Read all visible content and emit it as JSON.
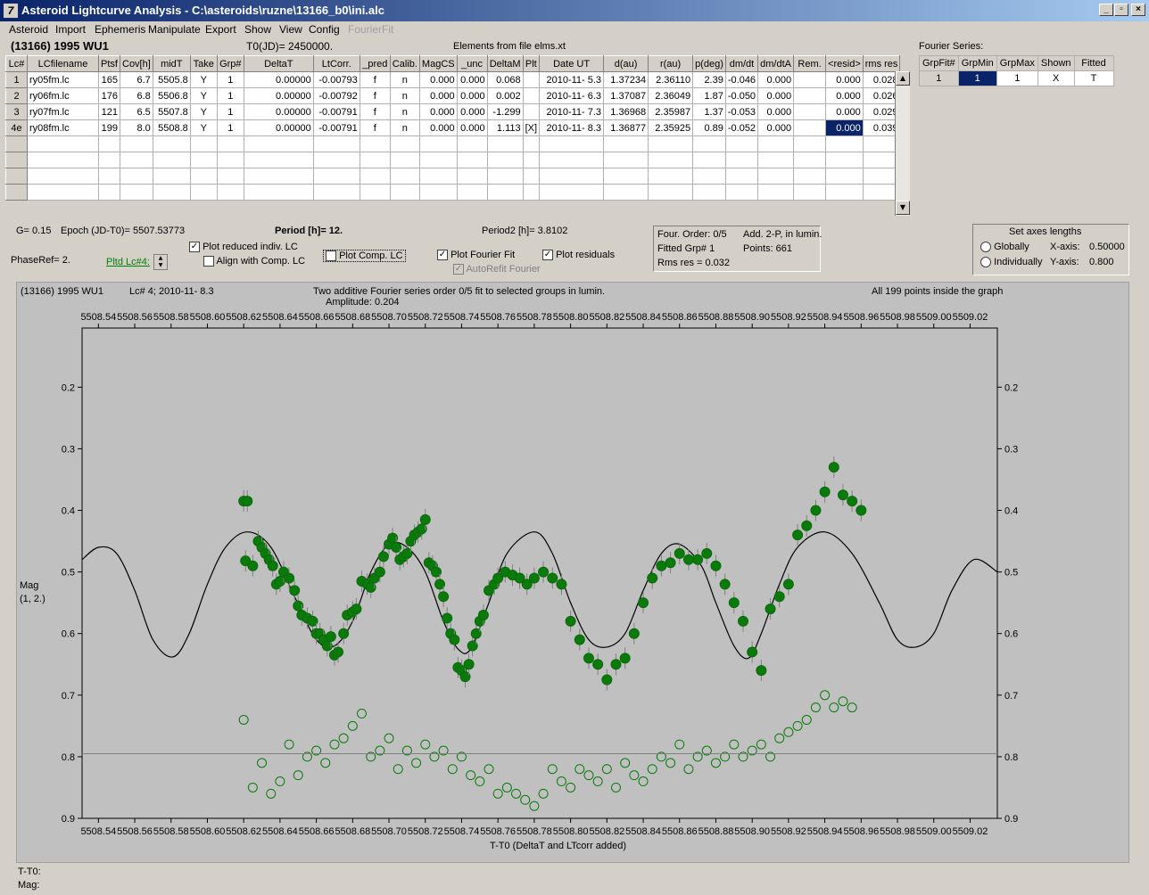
{
  "window": {
    "title": "Asteroid Lightcurve Analysis - C:\\asteroids\\ruzne\\13166_b0\\ini.alc",
    "btn_min": "_",
    "btn_max": "▫",
    "btn_close": "×"
  },
  "menu": [
    "Asteroid",
    "Import",
    "Ephemeris",
    "Manipulate",
    "Export",
    "Show",
    "View",
    "Config",
    "FourierFit"
  ],
  "header": {
    "asteroid": "(13166) 1995 WU1",
    "t0": "T0(JD)= 2450000.",
    "elements": "Elements from file elms.xt",
    "fourier_title": "Fourier Series:"
  },
  "table": {
    "columns": [
      "Lc#",
      "LCfilename",
      "Ptsf",
      "Cov[h]",
      "midT",
      "Take",
      "Grp#",
      "DeltaT",
      "LtCorr.",
      "_pred",
      "Calib.",
      "MagCS",
      "_unc",
      "DeltaM",
      "Plt",
      "Date UT",
      "d(au)",
      "r(au)",
      "p(deg)",
      "dm/dt",
      "dm/dtA",
      "Rem.",
      "<resid>",
      "rms res"
    ],
    "rows": [
      [
        "1",
        "ry05fm.lc",
        "165",
        "6.7",
        "5505.8",
        "Y",
        "1",
        "0.00000",
        "-0.00793",
        "f",
        "n",
        "0.000",
        "0.000",
        "0.068",
        "",
        "2010-11- 5.3",
        "1.37234",
        "2.36110",
        "2.39",
        "-0.046",
        "0.000",
        "",
        "0.000",
        "0.028"
      ],
      [
        "2",
        "ry06fm.lc",
        "176",
        "6.8",
        "5506.8",
        "Y",
        "1",
        "0.00000",
        "-0.00792",
        "f",
        "n",
        "0.000",
        "0.000",
        "0.002",
        "",
        "2010-11- 6.3",
        "1.37087",
        "2.36049",
        "1.87",
        "-0.050",
        "0.000",
        "",
        "0.000",
        "0.026"
      ],
      [
        "3",
        "ry07fm.lc",
        "121",
        "6.5",
        "5507.8",
        "Y",
        "1",
        "0.00000",
        "-0.00791",
        "f",
        "n",
        "0.000",
        "0.000",
        "-1.299",
        "",
        "2010-11- 7.3",
        "1.36968",
        "2.35987",
        "1.37",
        "-0.053",
        "0.000",
        "",
        "0.000",
        "0.029"
      ],
      [
        "4e",
        "ry08fm.lc",
        "199",
        "8.0",
        "5508.8",
        "Y",
        "1",
        "0.00000",
        "-0.00791",
        "f",
        "n",
        "0.000",
        "0.000",
        "1.113",
        "[X]",
        "2010-11- 8.3",
        "1.36877",
        "2.35925",
        "0.89",
        "-0.052",
        "0.000",
        "",
        "0.000",
        "0.039"
      ]
    ]
  },
  "fourier_table": {
    "columns": [
      "GrpFit#",
      "GrpMin",
      "GrpMax",
      "Shown",
      "Fitted"
    ],
    "row": [
      "1",
      "1",
      "1",
      "X",
      "T"
    ]
  },
  "controls": {
    "g": "G= 0.15",
    "epoch": "Epoch (JD-T0)= 5507.53773",
    "period": "Period [h]= 12.",
    "period2": "Period2 [h]= 3.8102",
    "phaseref": "PhaseRef= 2.",
    "pltd": "Pltd Lc#4:",
    "plot_reduced": "Plot reduced indiv. LC",
    "align": "Align with Comp. LC",
    "plot_comp": "Plot Comp. LC",
    "plot_fourier": "Plot Fourier Fit",
    "plot_resid": "Plot residuals",
    "autorefit": "AutoRefit Fourier",
    "check_on": "✓"
  },
  "info": {
    "order": "Four. Order:  0/5",
    "add": "Add. 2-P, in lumin.",
    "fitted": "Fitted Grp# 1",
    "points": "Points: 661",
    "rms": "Rms res     = 0.032"
  },
  "axes_box": {
    "title": "Set axes lengths",
    "globally": "Globally",
    "individually": "Individually",
    "xaxis_label": "X-axis:",
    "xaxis_value": "0.50000",
    "yaxis_label": "Y-axis:",
    "yaxis_value": "0.800"
  },
  "plot": {
    "top_left": "(13166) 1995 WU1",
    "lc": "Lc# 4; 2010-11- 8.3",
    "fit_title": "Two additive Fourier series order 0/5 fit to selected groups in lumin.",
    "amplitude": "Amplitude: 0.204",
    "inside": "All 199 points inside the graph",
    "ylabel": "Mag",
    "ylabel2": "(1, 2.)",
    "xlabel": "T-T0 (DeltaT and LTcorr added)"
  },
  "status": {
    "t": "T-T0:",
    "mag": "Mag:"
  },
  "chart_data": {
    "type": "scatter",
    "x_ticks": [
      "5508.54",
      "5508.56",
      "5508.58",
      "5508.60",
      "5508.62",
      "5508.64",
      "5508.66",
      "5508.68",
      "5508.70",
      "5508.72",
      "5508.74",
      "5508.76",
      "5508.78",
      "5508.80",
      "5508.82",
      "5508.84",
      "5508.86",
      "5508.88",
      "5508.90",
      "5508.92",
      "5508.94",
      "5508.96",
      "5508.98",
      "5509.00",
      "5509.02"
    ],
    "y_ticks": [
      "0.2",
      "0.3",
      "0.4",
      "0.5",
      "0.6",
      "0.7",
      "0.8",
      "0.9"
    ],
    "xlim": [
      5508.531,
      5509.035
    ],
    "ylim": [
      0.9,
      0.104
    ],
    "series": [
      {
        "type": "line",
        "color": "#000000",
        "points": [
          [
            5508.531,
            0.48
          ],
          [
            5508.54,
            0.46
          ],
          [
            5508.55,
            0.47
          ],
          [
            5508.56,
            0.53
          ],
          [
            5508.57,
            0.61
          ],
          [
            5508.581,
            0.638
          ],
          [
            5508.59,
            0.6
          ],
          [
            5508.6,
            0.52
          ],
          [
            5508.61,
            0.46
          ],
          [
            5508.622,
            0.435
          ],
          [
            5508.635,
            0.46
          ],
          [
            5508.648,
            0.54
          ],
          [
            5508.66,
            0.61
          ],
          [
            5508.67,
            0.62
          ],
          [
            5508.68,
            0.58
          ],
          [
            5508.69,
            0.5
          ],
          [
            5508.7,
            0.455
          ],
          [
            5508.71,
            0.46
          ],
          [
            5508.72,
            0.5
          ],
          [
            5508.73,
            0.58
          ],
          [
            5508.738,
            0.625
          ],
          [
            5508.745,
            0.625
          ],
          [
            5508.755,
            0.55
          ],
          [
            5508.765,
            0.47
          ],
          [
            5508.78,
            0.435
          ],
          [
            5508.79,
            0.47
          ],
          [
            5508.8,
            0.55
          ],
          [
            5508.81,
            0.61
          ],
          [
            5508.82,
            0.622
          ],
          [
            5508.83,
            0.6
          ],
          [
            5508.84,
            0.53
          ],
          [
            5508.85,
            0.47
          ],
          [
            5508.86,
            0.455
          ],
          [
            5508.872,
            0.49
          ],
          [
            5508.88,
            0.55
          ],
          [
            5508.89,
            0.62
          ],
          [
            5508.898,
            0.64
          ],
          [
            5508.905,
            0.6
          ],
          [
            5508.915,
            0.52
          ],
          [
            5508.925,
            0.46
          ],
          [
            5508.94,
            0.435
          ],
          [
            5508.955,
            0.47
          ],
          [
            5508.97,
            0.55
          ],
          [
            5508.98,
            0.61
          ],
          [
            5508.99,
            0.622
          ],
          [
            5509.0,
            0.6
          ],
          [
            5509.01,
            0.53
          ],
          [
            5509.022,
            0.48
          ],
          [
            5509.035,
            0.5
          ]
        ]
      },
      {
        "type": "points",
        "color": "#0a7a0a",
        "filled": true,
        "points": [
          [
            5508.62,
            0.385
          ],
          [
            5508.622,
            0.385
          ],
          [
            5508.621,
            0.482
          ],
          [
            5508.625,
            0.49
          ],
          [
            5508.628,
            0.45
          ],
          [
            5508.63,
            0.46
          ],
          [
            5508.632,
            0.47
          ],
          [
            5508.634,
            0.48
          ],
          [
            5508.636,
            0.49
          ],
          [
            5508.638,
            0.52
          ],
          [
            5508.64,
            0.515
          ],
          [
            5508.642,
            0.5
          ],
          [
            5508.645,
            0.51
          ],
          [
            5508.648,
            0.53
          ],
          [
            5508.65,
            0.555
          ],
          [
            5508.652,
            0.57
          ],
          [
            5508.655,
            0.575
          ],
          [
            5508.658,
            0.58
          ],
          [
            5508.66,
            0.6
          ],
          [
            5508.662,
            0.6
          ],
          [
            5508.664,
            0.61
          ],
          [
            5508.666,
            0.62
          ],
          [
            5508.668,
            0.605
          ],
          [
            5508.67,
            0.635
          ],
          [
            5508.672,
            0.63
          ],
          [
            5508.675,
            0.6
          ],
          [
            5508.677,
            0.57
          ],
          [
            5508.68,
            0.565
          ],
          [
            5508.682,
            0.56
          ],
          [
            5508.685,
            0.515
          ],
          [
            5508.688,
            0.52
          ],
          [
            5508.69,
            0.525
          ],
          [
            5508.692,
            0.51
          ],
          [
            5508.695,
            0.5
          ],
          [
            5508.697,
            0.475
          ],
          [
            5508.7,
            0.455
          ],
          [
            5508.702,
            0.445
          ],
          [
            5508.704,
            0.46
          ],
          [
            5508.706,
            0.48
          ],
          [
            5508.708,
            0.475
          ],
          [
            5508.71,
            0.47
          ],
          [
            5508.712,
            0.45
          ],
          [
            5508.714,
            0.44
          ],
          [
            5508.716,
            0.435
          ],
          [
            5508.718,
            0.43
          ],
          [
            5508.72,
            0.415
          ],
          [
            5508.722,
            0.485
          ],
          [
            5508.724,
            0.49
          ],
          [
            5508.726,
            0.5
          ],
          [
            5508.728,
            0.52
          ],
          [
            5508.73,
            0.54
          ],
          [
            5508.732,
            0.575
          ],
          [
            5508.734,
            0.6
          ],
          [
            5508.736,
            0.61
          ],
          [
            5508.738,
            0.655
          ],
          [
            5508.74,
            0.66
          ],
          [
            5508.742,
            0.67
          ],
          [
            5508.744,
            0.65
          ],
          [
            5508.746,
            0.62
          ],
          [
            5508.748,
            0.6
          ],
          [
            5508.75,
            0.58
          ],
          [
            5508.752,
            0.57
          ],
          [
            5508.755,
            0.53
          ],
          [
            5508.758,
            0.52
          ],
          [
            5508.76,
            0.51
          ],
          [
            5508.764,
            0.5
          ],
          [
            5508.768,
            0.505
          ],
          [
            5508.772,
            0.51
          ],
          [
            5508.776,
            0.52
          ],
          [
            5508.78,
            0.51
          ],
          [
            5508.785,
            0.5
          ],
          [
            5508.79,
            0.51
          ],
          [
            5508.795,
            0.52
          ],
          [
            5508.8,
            0.58
          ],
          [
            5508.805,
            0.61
          ],
          [
            5508.81,
            0.64
          ],
          [
            5508.815,
            0.65
          ],
          [
            5508.82,
            0.675
          ],
          [
            5508.825,
            0.65
          ],
          [
            5508.83,
            0.64
          ],
          [
            5508.835,
            0.6
          ],
          [
            5508.84,
            0.55
          ],
          [
            5508.845,
            0.51
          ],
          [
            5508.85,
            0.49
          ],
          [
            5508.855,
            0.485
          ],
          [
            5508.86,
            0.47
          ],
          [
            5508.865,
            0.48
          ],
          [
            5508.87,
            0.48
          ],
          [
            5508.875,
            0.47
          ],
          [
            5508.88,
            0.49
          ],
          [
            5508.885,
            0.52
          ],
          [
            5508.89,
            0.55
          ],
          [
            5508.895,
            0.58
          ],
          [
            5508.9,
            0.63
          ],
          [
            5508.905,
            0.66
          ],
          [
            5508.91,
            0.56
          ],
          [
            5508.915,
            0.54
          ],
          [
            5508.92,
            0.52
          ],
          [
            5508.925,
            0.44
          ],
          [
            5508.93,
            0.425
          ],
          [
            5508.935,
            0.4
          ],
          [
            5508.94,
            0.37
          ],
          [
            5508.945,
            0.33
          ],
          [
            5508.95,
            0.375
          ],
          [
            5508.955,
            0.385
          ],
          [
            5508.96,
            0.4
          ]
        ]
      },
      {
        "type": "points",
        "color": "#0a7a0a",
        "filled": false,
        "points": [
          [
            5508.62,
            0.74
          ],
          [
            5508.625,
            0.85
          ],
          [
            5508.63,
            0.81
          ],
          [
            5508.635,
            0.86
          ],
          [
            5508.64,
            0.84
          ],
          [
            5508.645,
            0.78
          ],
          [
            5508.65,
            0.83
          ],
          [
            5508.655,
            0.8
          ],
          [
            5508.66,
            0.79
          ],
          [
            5508.665,
            0.81
          ],
          [
            5508.67,
            0.78
          ],
          [
            5508.675,
            0.77
          ],
          [
            5508.68,
            0.75
          ],
          [
            5508.685,
            0.73
          ],
          [
            5508.69,
            0.8
          ],
          [
            5508.695,
            0.79
          ],
          [
            5508.7,
            0.77
          ],
          [
            5508.705,
            0.82
          ],
          [
            5508.71,
            0.79
          ],
          [
            5508.715,
            0.81
          ],
          [
            5508.72,
            0.78
          ],
          [
            5508.725,
            0.8
          ],
          [
            5508.73,
            0.79
          ],
          [
            5508.735,
            0.82
          ],
          [
            5508.74,
            0.8
          ],
          [
            5508.745,
            0.83
          ],
          [
            5508.75,
            0.84
          ],
          [
            5508.755,
            0.82
          ],
          [
            5508.76,
            0.86
          ],
          [
            5508.765,
            0.85
          ],
          [
            5508.77,
            0.86
          ],
          [
            5508.775,
            0.87
          ],
          [
            5508.78,
            0.88
          ],
          [
            5508.785,
            0.86
          ],
          [
            5508.79,
            0.82
          ],
          [
            5508.795,
            0.84
          ],
          [
            5508.8,
            0.85
          ],
          [
            5508.805,
            0.82
          ],
          [
            5508.81,
            0.83
          ],
          [
            5508.815,
            0.84
          ],
          [
            5508.82,
            0.82
          ],
          [
            5508.825,
            0.85
          ],
          [
            5508.83,
            0.81
          ],
          [
            5508.835,
            0.83
          ],
          [
            5508.84,
            0.84
          ],
          [
            5508.845,
            0.82
          ],
          [
            5508.85,
            0.8
          ],
          [
            5508.855,
            0.81
          ],
          [
            5508.86,
            0.78
          ],
          [
            5508.865,
            0.82
          ],
          [
            5508.87,
            0.8
          ],
          [
            5508.875,
            0.79
          ],
          [
            5508.88,
            0.81
          ],
          [
            5508.885,
            0.8
          ],
          [
            5508.89,
            0.78
          ],
          [
            5508.895,
            0.8
          ],
          [
            5508.9,
            0.79
          ],
          [
            5508.905,
            0.78
          ],
          [
            5508.91,
            0.8
          ],
          [
            5508.915,
            0.77
          ],
          [
            5508.92,
            0.76
          ],
          [
            5508.925,
            0.75
          ],
          [
            5508.93,
            0.74
          ],
          [
            5508.935,
            0.72
          ],
          [
            5508.94,
            0.7
          ],
          [
            5508.945,
            0.72
          ],
          [
            5508.95,
            0.71
          ],
          [
            5508.955,
            0.72
          ]
        ]
      },
      {
        "type": "hline",
        "color": "#808080",
        "y": 0.795
      }
    ]
  }
}
